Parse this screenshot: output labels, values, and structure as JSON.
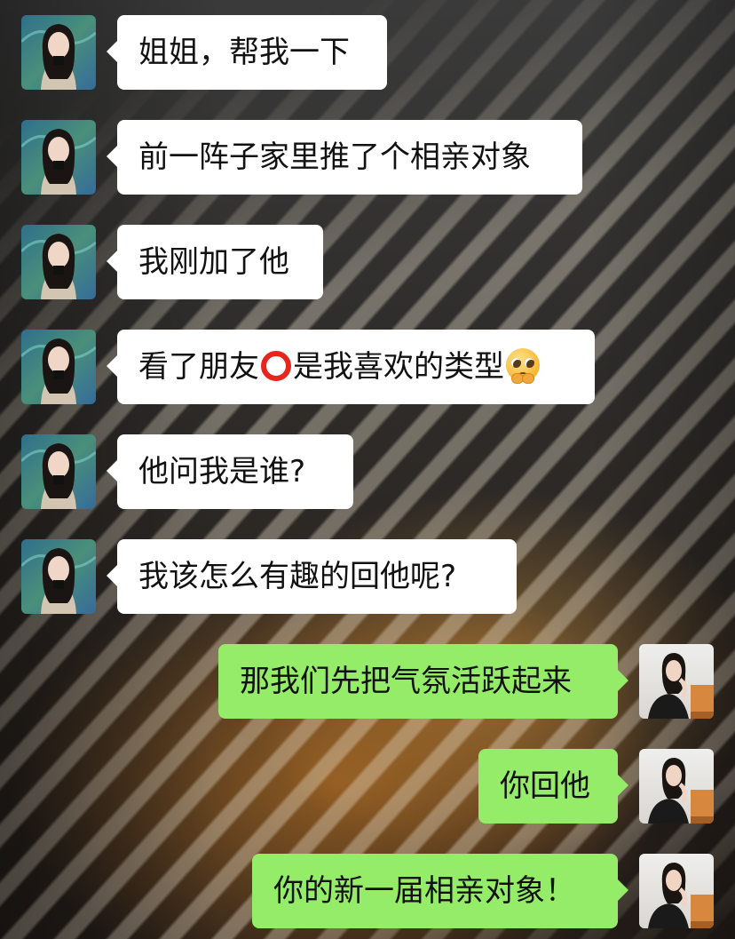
{
  "colors": {
    "incoming_bubble": "#ffffff",
    "outgoing_bubble": "#95ec69",
    "text": "#111111"
  },
  "messages": [
    {
      "side": "in",
      "text": "姐姐，帮我一下"
    },
    {
      "side": "in",
      "text": "前一阵子家里推了个相亲对象"
    },
    {
      "side": "in",
      "text": "我刚加了他"
    },
    {
      "side": "in",
      "text_before": "看了朋友",
      "text_after": "是我喜欢的类型",
      "emoji_mid": "red-circle-icon",
      "emoji_end": "pleading-face-icon"
    },
    {
      "side": "in",
      "text": "他问我是谁?"
    },
    {
      "side": "in",
      "text": "我该怎么有趣的回他呢?"
    },
    {
      "side": "out",
      "text": "那我们先把气氛活跃起来"
    },
    {
      "side": "out",
      "text": "你回他"
    },
    {
      "side": "out",
      "text": "你的新一届相亲对象！"
    }
  ]
}
